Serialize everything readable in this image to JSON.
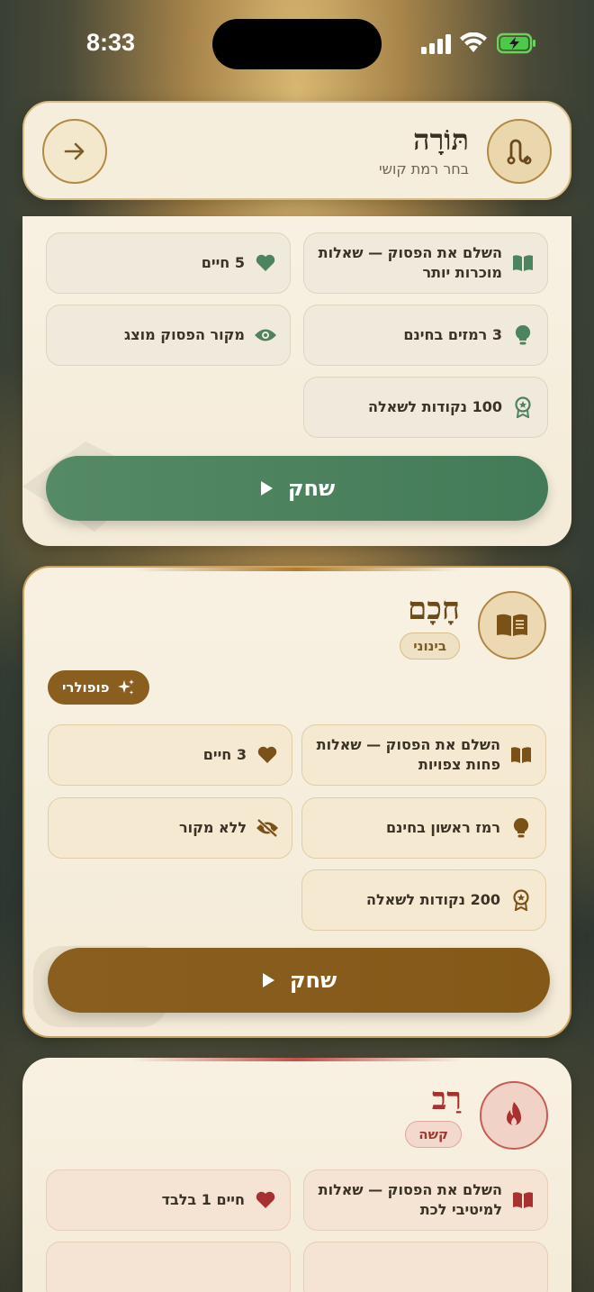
{
  "status_bar": {
    "time": "8:33"
  },
  "header": {
    "title": "תּוֹרָה",
    "subtitle": "בחר רמת קושי"
  },
  "levels": [
    {
      "id": "torah",
      "features": {
        "f1": "השלם את הפסוק — שאלות מוכרות יותר",
        "f2": "5 חיים",
        "f3": "3 רמזים בחינם",
        "f4": "מקור הפסוק מוצג",
        "f5": "100 נקודות לשאלה"
      },
      "play_label": "שחק",
      "accent": "#4e8360"
    },
    {
      "id": "hacham",
      "title": "חָכָם",
      "badge": "בינוני",
      "popular_label": "פופולרי",
      "features": {
        "f1": "השלם את הפסוק — שאלות פחות צפויות",
        "f2": "3 חיים",
        "f3": "רמז ראשון בחינם",
        "f4": "ללא מקור",
        "f5": "200 נקודות לשאלה"
      },
      "play_label": "שחק",
      "accent": "#8a5e1f"
    },
    {
      "id": "rav",
      "title": "רַב",
      "badge": "קשה",
      "features": {
        "f1": "השלם את הפסוק — שאלות למיטיבי לכת",
        "f2": "חיים 1 בלבד"
      },
      "accent": "#b23a3a"
    }
  ]
}
